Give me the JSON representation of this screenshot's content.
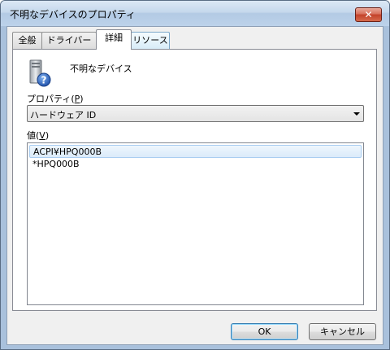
{
  "window": {
    "title": "不明なデバイスのプロパティ",
    "close_glyph": "✕"
  },
  "tabs": [
    {
      "label": "全般",
      "active": false
    },
    {
      "label": "ドライバー",
      "active": false
    },
    {
      "label": "詳細",
      "active": true
    },
    {
      "label": "リソース",
      "active": false
    }
  ],
  "device": {
    "icon": "unknown-device-icon",
    "name": "不明なデバイス"
  },
  "property": {
    "label_text": "プロパティ(",
    "label_mnemonic": "P",
    "label_close": ")",
    "selected": "ハードウェア ID"
  },
  "value": {
    "label_text": "値(",
    "label_mnemonic": "V",
    "label_close": ")",
    "items": [
      {
        "text": "ACPI¥HPQ000B",
        "selected": true
      },
      {
        "text": "*HPQ000B",
        "selected": false
      }
    ]
  },
  "buttons": {
    "ok": "OK",
    "cancel": "キャンセル"
  },
  "colors": {
    "selection_border": "#a9cdf1",
    "close_button": "#c2412a"
  }
}
